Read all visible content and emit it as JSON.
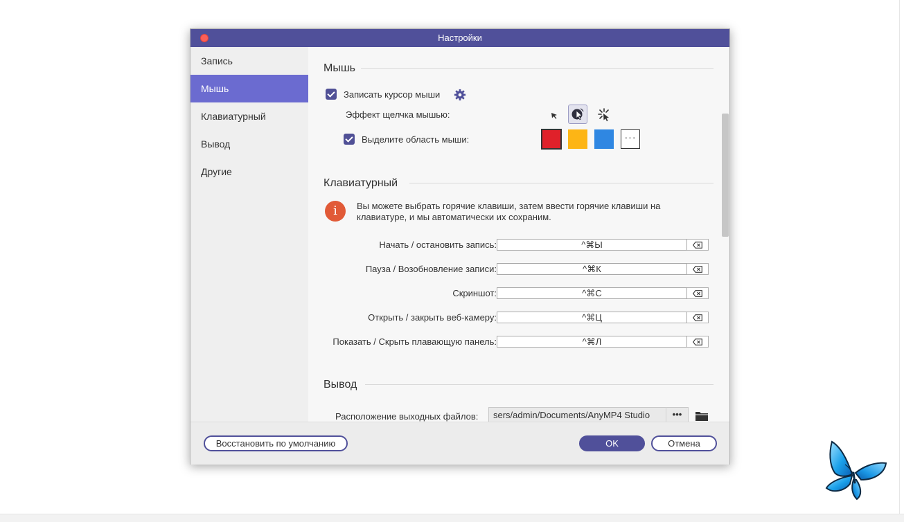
{
  "dialog": {
    "title": "Настройки"
  },
  "sidebar": {
    "items": [
      {
        "label": "Запись",
        "active": false
      },
      {
        "label": "Мышь",
        "active": true
      },
      {
        "label": "Клавиатурный",
        "active": false
      },
      {
        "label": "Вывод",
        "active": false
      },
      {
        "label": "Другие",
        "active": false
      }
    ]
  },
  "mouse": {
    "section_title": "Мышь",
    "record_cursor_label": "Записать курсор мыши",
    "record_cursor_checked": true,
    "click_effect_label": "Эффект щелчка мышью:",
    "click_effect_options": [
      "arrow-cursor-icon",
      "click-ripple-cursor-icon",
      "click-burst-cursor-icon"
    ],
    "click_effect_selected": 1,
    "highlight_label": "Выделите область мыши:",
    "highlight_checked": true,
    "highlight_colors": [
      "#e0212a",
      "#fdb515",
      "#2f87e2"
    ],
    "highlight_selected": 0,
    "more_colors_label": "···"
  },
  "keyboard": {
    "section_title": "Клавиатурный",
    "info_icon_glyph": "i",
    "info_text": "Вы можете выбрать горячие клавиши, затем ввести горячие клавиши на клавиатуре, и мы автоматически их сохраним.",
    "hotkeys": [
      {
        "label": "Начать / остановить запись:",
        "value": "^⌘Ы"
      },
      {
        "label": "Пауза / Возобновление записи:",
        "value": "^⌘К"
      },
      {
        "label": "Скриншот:",
        "value": "^⌘С"
      },
      {
        "label": "Открыть / закрыть веб-камеру:",
        "value": "^⌘Ц"
      },
      {
        "label": "Показать / Скрыть плавающую панель:",
        "value": "^⌘Л"
      }
    ]
  },
  "output": {
    "section_title": "Вывод",
    "location_label": "Расположение выходных файлов:",
    "location_value": "sers/admin/Documents/AnyMP4 Studio",
    "browse_label": "•••"
  },
  "footer": {
    "restore_label": "Восстановить по умолчанию",
    "ok_label": "OK",
    "cancel_label": "Отмена"
  },
  "colors": {
    "accent": "#50509a",
    "sidebar_active": "#6b6bd0",
    "info_icon": "#e15a37"
  }
}
